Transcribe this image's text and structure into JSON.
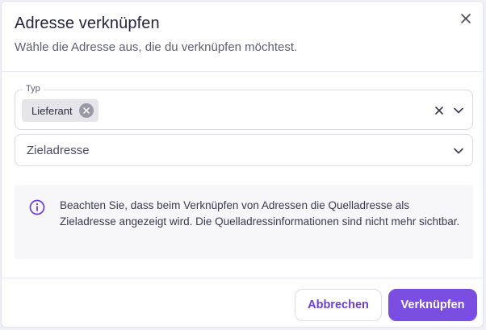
{
  "dialog": {
    "title": "Adresse verknüpfen",
    "subtitle": "Wähle die Adresse aus, die du verknüpfen möchtest.",
    "close_icon": "close-icon"
  },
  "form": {
    "type_field": {
      "legend": "Typ",
      "selected_chip": "Lieferant"
    },
    "target_field": {
      "placeholder": "Zieladresse"
    }
  },
  "info": {
    "icon": "info-icon",
    "text": "Beachten Sie, dass beim Verknüpfen von Adressen die Quelladresse als Zieladresse angezeigt wird. Die Quelladressinformationen sind nicht mehr sichtbar."
  },
  "footer": {
    "cancel_label": "Abbrechen",
    "confirm_label": "Verknüpfen"
  },
  "colors": {
    "accent": "#7a4ee0",
    "info_icon": "#6b3fd0"
  }
}
